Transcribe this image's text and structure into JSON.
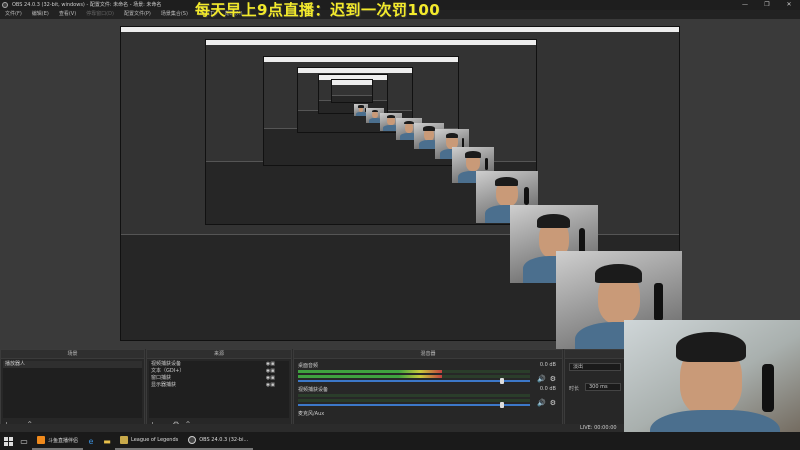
{
  "window": {
    "title": "OBS 24.0.3 (32-bit, windows) - 配置文件: 未命名 - 场景: 未命名",
    "buttons": [
      "—",
      "❐",
      "✕"
    ]
  },
  "menu": [
    {
      "label": "文件(F)",
      "disabled": false
    },
    {
      "label": "编辑(E)",
      "disabled": false
    },
    {
      "label": "查看(V)",
      "disabled": false
    },
    {
      "label": "停靠窗口(D)",
      "disabled": true
    },
    {
      "label": "配置文件(P)",
      "disabled": false
    },
    {
      "label": "场景集合(S)",
      "disabled": false
    },
    {
      "label": "工具(T)",
      "disabled": false
    },
    {
      "label": "帮助(H)",
      "disabled": false
    }
  ],
  "banner": "每天早上9点直播：迟到一次罚100",
  "docks": {
    "scenes": {
      "title": "场景",
      "items": [
        "播放器人"
      ]
    },
    "sources": {
      "title": "来源",
      "items": [
        "视频捕获设备",
        "文本（GDI+）",
        "窗口捕获",
        "显示器捕获"
      ]
    },
    "mixer": {
      "title": "混音器",
      "tracks": [
        {
          "name": "桌面音频",
          "db": "0.0 dB",
          "level": 0.62,
          "fader": 0.88
        },
        {
          "name": "视频捕获设备",
          "db": "0.0 dB",
          "level": 0.0,
          "fader": 0.88
        },
        {
          "name": "麦克风/Aux",
          "db": "",
          "level": 0.0,
          "fader": 0.88
        }
      ]
    },
    "transitions": {
      "title": "转场特效",
      "type_label": "淡出",
      "duration_label": "时长",
      "duration": "300 ms"
    }
  },
  "status": {
    "live": "LIVE: 00:00:00"
  },
  "taskbar": {
    "apps": [
      {
        "label": "斗鱼直播伴侣",
        "color": "#f08a1c"
      },
      {
        "label": "League of Legends",
        "color": "#c8a94a"
      },
      {
        "label": "OBS 24.0.3 (32-bi...",
        "color": "#444444"
      }
    ]
  }
}
